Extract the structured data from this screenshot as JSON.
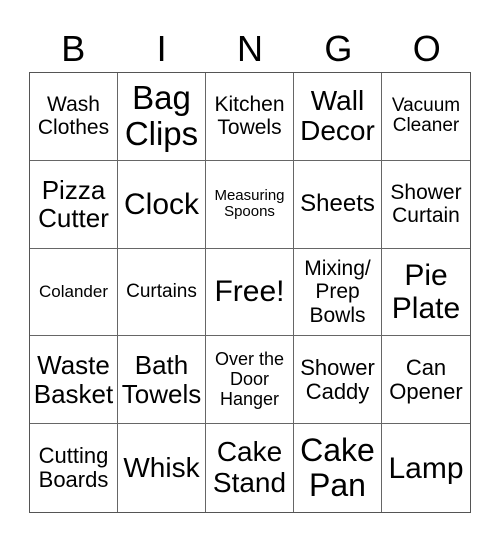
{
  "header": {
    "letters": [
      "B",
      "I",
      "N",
      "G",
      "O"
    ]
  },
  "cells": [
    "Wash Clothes",
    "Bag Clips",
    "Kitchen Towels",
    "Wall Decor",
    "Vacuum Cleaner",
    "Pizza Cutter",
    "Clock",
    "Measuring Spoons",
    "Sheets",
    "Shower Curtain",
    "Colander",
    "Curtains",
    "Free!",
    "Mixing/ Prep Bowls",
    "Pie Plate",
    "Waste Basket",
    "Bath Towels",
    "Over the Door Hanger",
    "Shower Caddy",
    "Can Opener",
    "Cutting Boards",
    "Whisk",
    "Cake Stand",
    "Cake Pan",
    "Lamp"
  ]
}
